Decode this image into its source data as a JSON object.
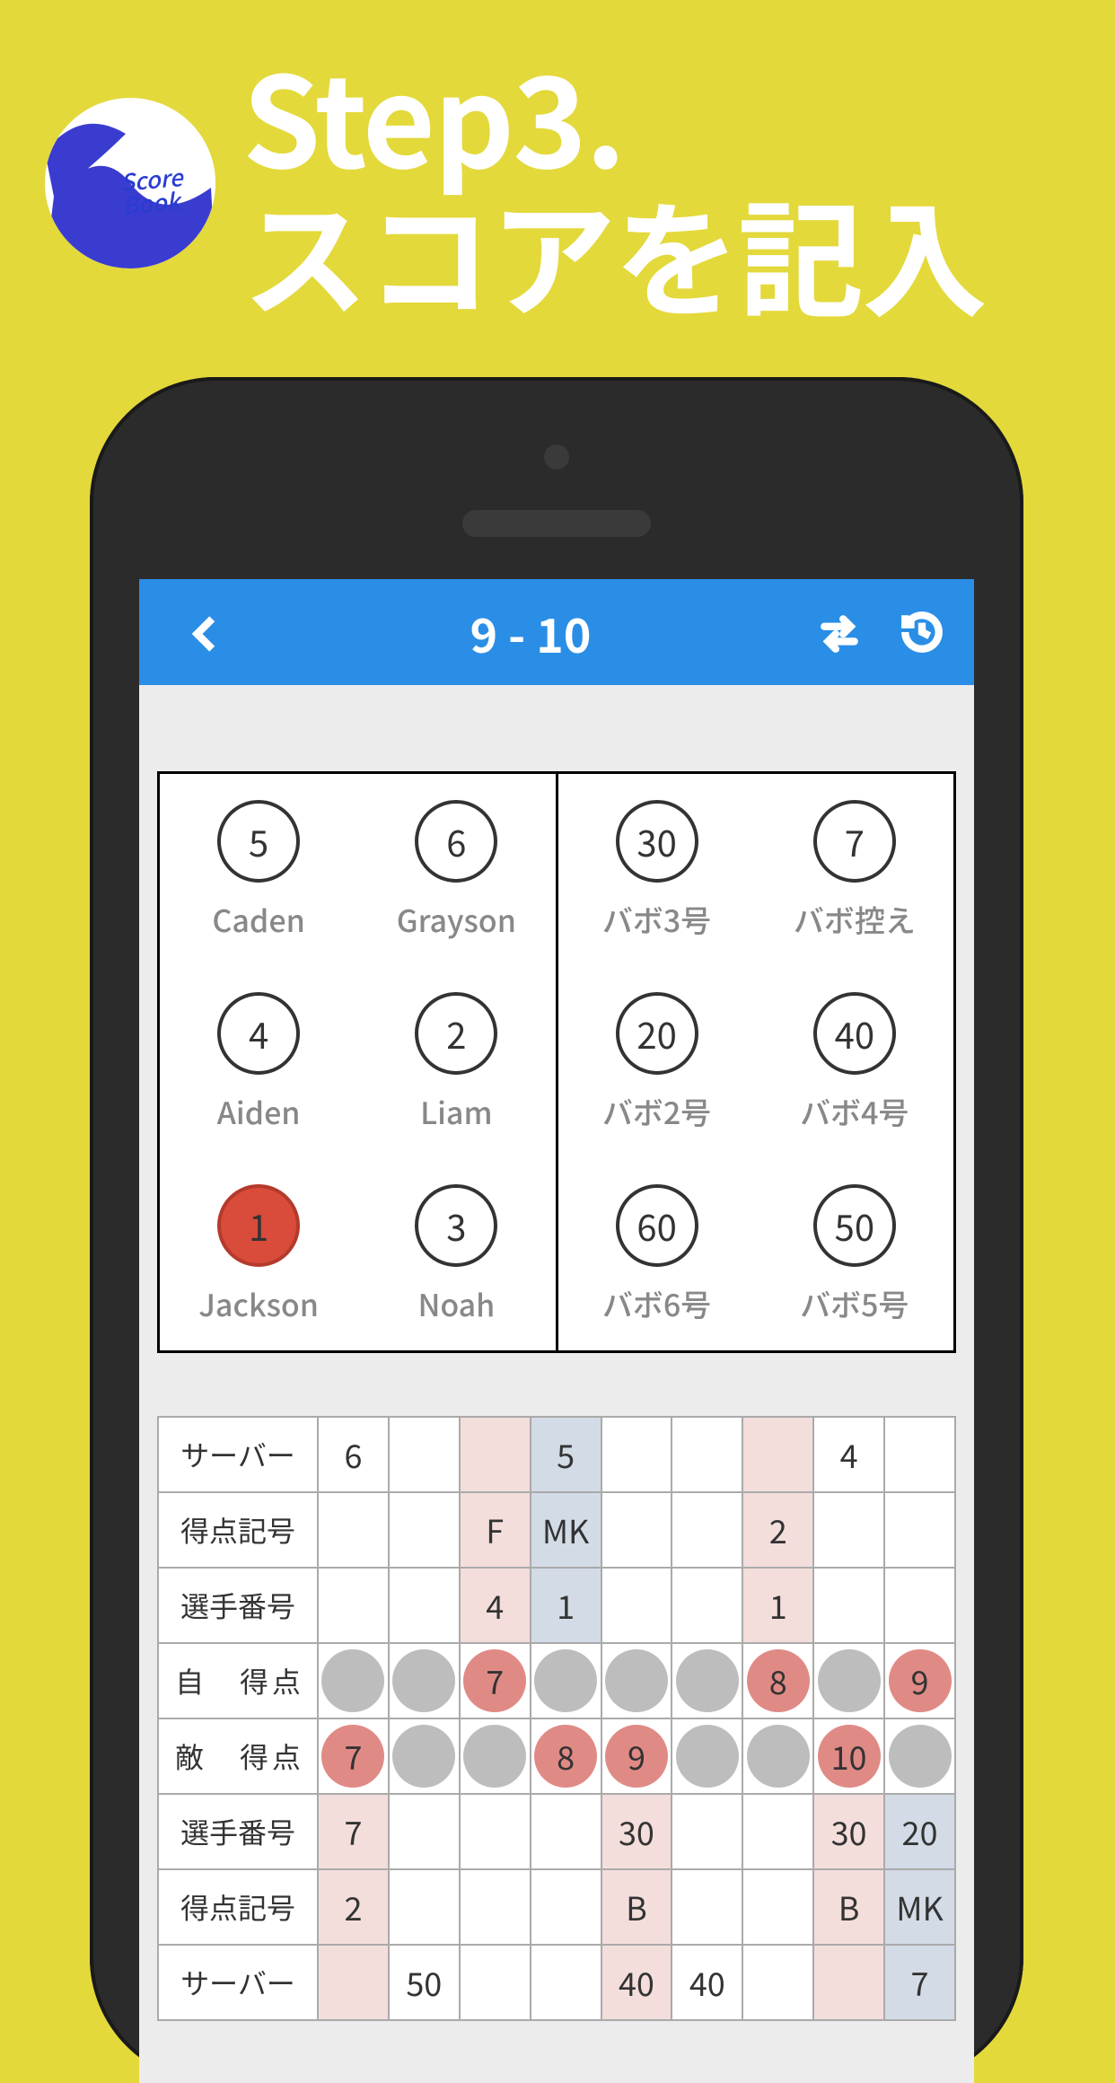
{
  "hero": {
    "step": "Step3.",
    "subtitle": "スコアを記入",
    "logo_text": "Score\nBook"
  },
  "appbar": {
    "score": "9 - 10"
  },
  "court": {
    "left": [
      {
        "num": "5",
        "name": "Caden",
        "server": false
      },
      {
        "num": "6",
        "name": "Grayson",
        "server": false
      },
      {
        "num": "4",
        "name": "Aiden",
        "server": false
      },
      {
        "num": "2",
        "name": "Liam",
        "server": false
      },
      {
        "num": "1",
        "name": "Jackson",
        "server": true
      },
      {
        "num": "3",
        "name": "Noah",
        "server": false
      }
    ],
    "right": [
      {
        "num": "30",
        "name": "バボ3号",
        "server": false
      },
      {
        "num": "7",
        "name": "バボ控え",
        "server": false
      },
      {
        "num": "20",
        "name": "バボ2号",
        "server": false
      },
      {
        "num": "40",
        "name": "バボ4号",
        "server": false
      },
      {
        "num": "60",
        "name": "バボ6号",
        "server": false
      },
      {
        "num": "50",
        "name": "バボ5号",
        "server": false
      }
    ]
  },
  "table": {
    "labels": {
      "server": "サーバー",
      "mark": "得点記号",
      "pnum": "選手番号",
      "own": "自　得点",
      "opp": "敵　得点"
    },
    "top": {
      "server": [
        "6",
        "",
        "",
        "5",
        "",
        "",
        "",
        "4",
        ""
      ],
      "mark": [
        "",
        "",
        "F",
        "MK",
        "",
        "",
        "2",
        "",
        ""
      ],
      "pnum": [
        "",
        "",
        "4",
        "1",
        "",
        "",
        "1",
        "",
        ""
      ]
    },
    "own_dots": [
      {
        "v": "",
        "c": "grey"
      },
      {
        "v": "",
        "c": "grey"
      },
      {
        "v": "7",
        "c": "red"
      },
      {
        "v": "",
        "c": "grey"
      },
      {
        "v": "",
        "c": "grey"
      },
      {
        "v": "",
        "c": "grey"
      },
      {
        "v": "8",
        "c": "red"
      },
      {
        "v": "",
        "c": "grey"
      },
      {
        "v": "9",
        "c": "red"
      }
    ],
    "opp_dots": [
      {
        "v": "7",
        "c": "red"
      },
      {
        "v": "",
        "c": "grey"
      },
      {
        "v": "",
        "c": "grey"
      },
      {
        "v": "8",
        "c": "red"
      },
      {
        "v": "9",
        "c": "red"
      },
      {
        "v": "",
        "c": "grey"
      },
      {
        "v": "",
        "c": "grey"
      },
      {
        "v": "10",
        "c": "red"
      },
      {
        "v": "",
        "c": "grey"
      }
    ],
    "bottom": {
      "pnum": [
        "7",
        "",
        "",
        "",
        "30",
        "",
        "",
        "30",
        "20"
      ],
      "mark": [
        "2",
        "",
        "",
        "",
        "B",
        "",
        "",
        "B",
        "MK"
      ],
      "server": [
        "",
        "50",
        "",
        "",
        "40",
        "40",
        "",
        "",
        "7"
      ]
    },
    "colors": {
      "top": [
        "",
        "",
        "pink",
        "blue",
        "",
        "",
        "pink",
        "",
        ""
      ],
      "bottom": [
        "pink",
        "",
        "",
        "",
        "pink",
        "",
        "",
        "pink",
        "blue"
      ]
    }
  }
}
